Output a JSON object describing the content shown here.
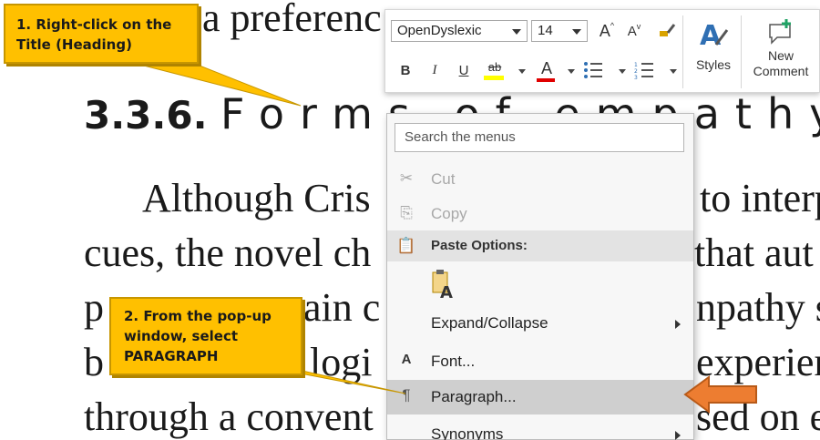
{
  "document": {
    "line_top": "a preferenc",
    "heading_number": "3.3.6.",
    "heading_title": "Forms of empathy",
    "para_line1": "Although Cris",
    "para_line1_right": "to interp",
    "para_line2": "cues, the novel ch",
    "para_line2_right": "that aut",
    "para_line3": "p",
    "para_line3_mid": "ain c",
    "para_line3_right": "npathy s",
    "para_line4": "b",
    "para_line4_mid": "logi",
    "para_line4_right": "experien",
    "para_line5": "through a convent",
    "para_line5_right": "sed on e"
  },
  "mini_toolbar": {
    "font_name": "OpenDyslexic",
    "font_size": "14",
    "grow_font": "A",
    "shrink_font": "A",
    "bold": "B",
    "italic": "I",
    "underline": "U",
    "highlight": "ab",
    "font_color": "A",
    "styles_label": "Styles",
    "new_comment_label_1": "New",
    "new_comment_label_2": "Comment",
    "highlight_color": "#ffff00",
    "font_color_value": "#e00000"
  },
  "context_menu": {
    "search_placeholder": "Search the menus",
    "cut": "Cut",
    "copy": "Copy",
    "paste_options": "Paste Options:",
    "expand_collapse": "Expand/Collapse",
    "font": "Font...",
    "paragraph": "Paragraph...",
    "synonyms": "Synonyms"
  },
  "callouts": {
    "step1": "1. Right-click on the Title (Heading)",
    "step2_line1": "2. From the pop-up",
    "step2_line2": "window, select",
    "step2_line3": "PARAGRAPH",
    "color": "#ffc000",
    "arrow_color": "#ed7d31"
  }
}
